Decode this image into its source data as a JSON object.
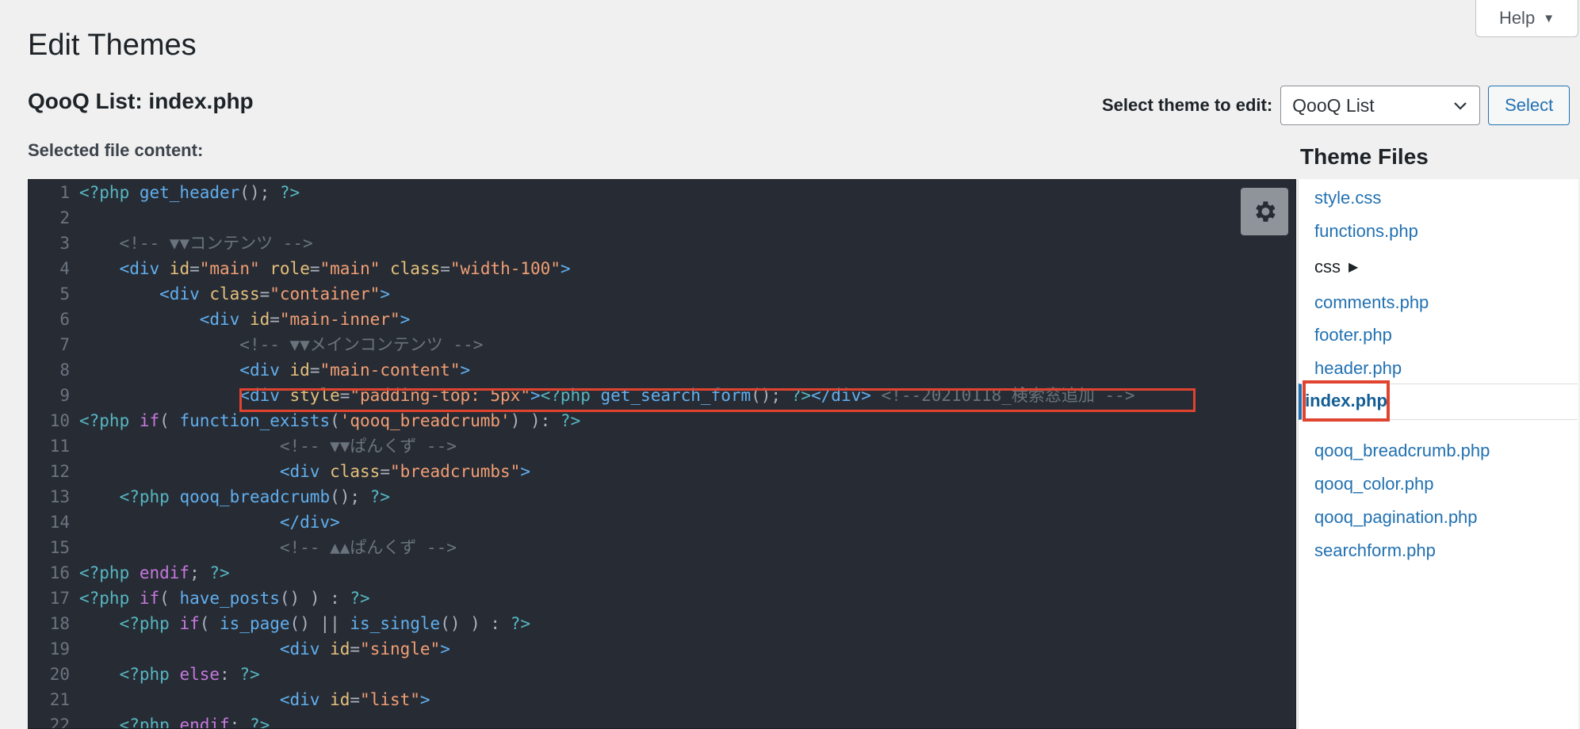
{
  "help": {
    "label": "Help"
  },
  "page": {
    "title": "Edit Themes",
    "file_heading": "QooQ List: index.php",
    "content_label": "Selected file content:"
  },
  "theme_select": {
    "label": "Select theme to edit:",
    "value": "QooQ List",
    "button": "Select"
  },
  "theme_files": {
    "title": "Theme Files",
    "items": [
      {
        "label": "style.css",
        "kind": "file"
      },
      {
        "label": "functions.php",
        "kind": "file"
      },
      {
        "label": "css",
        "kind": "folder"
      },
      {
        "label": "comments.php",
        "kind": "file"
      },
      {
        "label": "footer.php",
        "kind": "file"
      },
      {
        "label": "header.php",
        "kind": "file"
      },
      {
        "label": "index.php",
        "kind": "file",
        "active": true
      },
      {
        "label": "qooq_breadcrumb.php",
        "kind": "file"
      },
      {
        "label": "qooq_color.php",
        "kind": "file"
      },
      {
        "label": "qooq_pagination.php",
        "kind": "file"
      },
      {
        "label": "searchform.php",
        "kind": "file"
      }
    ]
  },
  "editor": {
    "highlighted_line": 9,
    "lines": [
      {
        "n": "1",
        "tokens": [
          [
            "php",
            "<?php "
          ],
          [
            "fn",
            "get_header"
          ],
          [
            "plain",
            "(); "
          ],
          [
            "php",
            "?>"
          ]
        ]
      },
      {
        "n": "2",
        "tokens": []
      },
      {
        "n": "3",
        "tokens": [
          [
            "plain",
            "    "
          ],
          [
            "cm",
            "<!-- ▼▼コンテンツ -->"
          ]
        ]
      },
      {
        "n": "4",
        "tokens": [
          [
            "plain",
            "    "
          ],
          [
            "tag",
            "<div "
          ],
          [
            "attr",
            "id"
          ],
          [
            "plain",
            "="
          ],
          [
            "str",
            "\"main\""
          ],
          [
            "plain",
            " "
          ],
          [
            "attr",
            "role"
          ],
          [
            "plain",
            "="
          ],
          [
            "str",
            "\"main\""
          ],
          [
            "plain",
            " "
          ],
          [
            "attr",
            "class"
          ],
          [
            "plain",
            "="
          ],
          [
            "str",
            "\"width-100\""
          ],
          [
            "tag",
            ">"
          ]
        ]
      },
      {
        "n": "5",
        "tokens": [
          [
            "plain",
            "        "
          ],
          [
            "tag",
            "<div "
          ],
          [
            "attr",
            "class"
          ],
          [
            "plain",
            "="
          ],
          [
            "str",
            "\"container\""
          ],
          [
            "tag",
            ">"
          ]
        ]
      },
      {
        "n": "6",
        "tokens": [
          [
            "plain",
            "            "
          ],
          [
            "tag",
            "<div "
          ],
          [
            "attr",
            "id"
          ],
          [
            "plain",
            "="
          ],
          [
            "str",
            "\"main-inner\""
          ],
          [
            "tag",
            ">"
          ]
        ]
      },
      {
        "n": "7",
        "tokens": [
          [
            "plain",
            "                "
          ],
          [
            "cm",
            "<!-- ▼▼メインコンテンツ -->"
          ]
        ]
      },
      {
        "n": "8",
        "tokens": [
          [
            "plain",
            "                "
          ],
          [
            "tag",
            "<div "
          ],
          [
            "attr",
            "id"
          ],
          [
            "plain",
            "="
          ],
          [
            "str",
            "\"main-content\""
          ],
          [
            "tag",
            ">"
          ]
        ]
      },
      {
        "n": "9",
        "tokens": [
          [
            "plain",
            "                "
          ],
          [
            "tag",
            "<div "
          ],
          [
            "attr",
            "style"
          ],
          [
            "plain",
            "="
          ],
          [
            "str",
            "\"padding-top: 5px\""
          ],
          [
            "tag",
            ">"
          ],
          [
            "php",
            "<?php "
          ],
          [
            "fn",
            "get_search_form"
          ],
          [
            "plain",
            "(); "
          ],
          [
            "php",
            "?>"
          ],
          [
            "tag",
            "</div>"
          ],
          [
            "plain",
            " "
          ],
          [
            "cm",
            "<!--20210118_検索窓追加 -->"
          ]
        ]
      },
      {
        "n": "10",
        "tokens": [
          [
            "php",
            "<?php "
          ],
          [
            "kw",
            "if"
          ],
          [
            "plain",
            "( "
          ],
          [
            "fn",
            "function_exists"
          ],
          [
            "plain",
            "("
          ],
          [
            "str",
            "'qooq_breadcrumb'"
          ],
          [
            "plain",
            ") ): "
          ],
          [
            "php",
            "?>"
          ]
        ]
      },
      {
        "n": "11",
        "tokens": [
          [
            "plain",
            "                    "
          ],
          [
            "cm",
            "<!-- ▼▼ぱんくず -->"
          ]
        ]
      },
      {
        "n": "12",
        "tokens": [
          [
            "plain",
            "                    "
          ],
          [
            "tag",
            "<div "
          ],
          [
            "attr",
            "class"
          ],
          [
            "plain",
            "="
          ],
          [
            "str",
            "\"breadcrumbs\""
          ],
          [
            "tag",
            ">"
          ]
        ]
      },
      {
        "n": "13",
        "tokens": [
          [
            "plain",
            "    "
          ],
          [
            "php",
            "<?php "
          ],
          [
            "fn",
            "qooq_breadcrumb"
          ],
          [
            "plain",
            "(); "
          ],
          [
            "php",
            "?>"
          ]
        ]
      },
      {
        "n": "14",
        "tokens": [
          [
            "plain",
            "                    "
          ],
          [
            "tag",
            "</div>"
          ]
        ]
      },
      {
        "n": "15",
        "tokens": [
          [
            "plain",
            "                    "
          ],
          [
            "cm",
            "<!-- ▲▲ぱんくず -->"
          ]
        ]
      },
      {
        "n": "16",
        "tokens": [
          [
            "php",
            "<?php "
          ],
          [
            "kw",
            "endif"
          ],
          [
            "plain",
            "; "
          ],
          [
            "php",
            "?>"
          ]
        ]
      },
      {
        "n": "17",
        "tokens": [
          [
            "php",
            "<?php "
          ],
          [
            "kw",
            "if"
          ],
          [
            "plain",
            "( "
          ],
          [
            "fn",
            "have_posts"
          ],
          [
            "plain",
            "() ) : "
          ],
          [
            "php",
            "?>"
          ]
        ]
      },
      {
        "n": "18",
        "tokens": [
          [
            "plain",
            "    "
          ],
          [
            "php",
            "<?php "
          ],
          [
            "kw",
            "if"
          ],
          [
            "plain",
            "( "
          ],
          [
            "fn",
            "is_page"
          ],
          [
            "plain",
            "() || "
          ],
          [
            "fn",
            "is_single"
          ],
          [
            "plain",
            "() ) : "
          ],
          [
            "php",
            "?>"
          ]
        ]
      },
      {
        "n": "19",
        "tokens": [
          [
            "plain",
            "                    "
          ],
          [
            "tag",
            "<div "
          ],
          [
            "attr",
            "id"
          ],
          [
            "plain",
            "="
          ],
          [
            "str",
            "\"single\""
          ],
          [
            "tag",
            ">"
          ]
        ]
      },
      {
        "n": "20",
        "tokens": [
          [
            "plain",
            "    "
          ],
          [
            "php",
            "<?php "
          ],
          [
            "kw",
            "else"
          ],
          [
            "plain",
            ": "
          ],
          [
            "php",
            "?>"
          ]
        ]
      },
      {
        "n": "21",
        "tokens": [
          [
            "plain",
            "                    "
          ],
          [
            "tag",
            "<div "
          ],
          [
            "attr",
            "id"
          ],
          [
            "plain",
            "="
          ],
          [
            "str",
            "\"list\""
          ],
          [
            "tag",
            ">"
          ]
        ]
      },
      {
        "n": "22",
        "tokens": [
          [
            "plain",
            "    "
          ],
          [
            "php",
            "<?php "
          ],
          [
            "kw",
            "endif"
          ],
          [
            "plain",
            "; "
          ],
          [
            "php",
            "?>"
          ]
        ]
      }
    ]
  },
  "colors": {
    "accent": "#2271b1",
    "annotation": "#e0432f",
    "editor_bg": "#272c34"
  }
}
